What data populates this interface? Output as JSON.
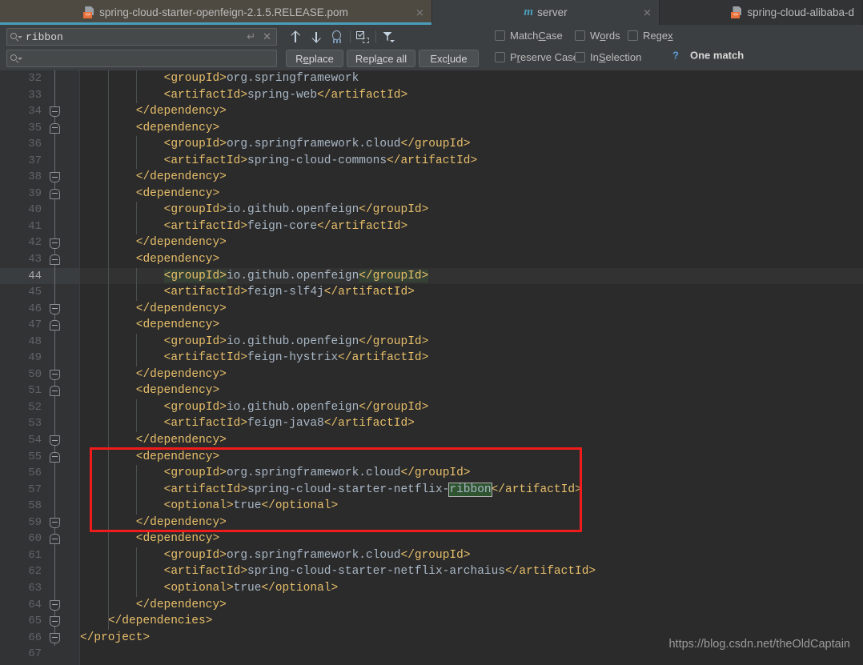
{
  "tabs": [
    {
      "label": "spring-cloud-starter-openfeign-2.1.5.RELEASE.pom",
      "icon": "pom-file-icon",
      "active": true,
      "closable": true
    },
    {
      "label": "server",
      "icon": "maven-module-icon",
      "active": false,
      "closable": true
    },
    {
      "label": "spring-cloud-alibaba-d",
      "icon": "pom-file-icon",
      "active": false,
      "closable": false
    }
  ],
  "find": {
    "search_value": "ribbon",
    "search_placeholder": "",
    "replace_value": "",
    "replace_placeholder": "",
    "enter_glyph": "↵",
    "clear_glyph": "✕",
    "toolbar": {
      "prev_title": "prev-occurrence",
      "next_title": "next-occurrence",
      "find_all_title": "find-all",
      "select_all_title": "select-all-occurrences",
      "filter_title": "filter-search-options"
    },
    "buttons": {
      "replace": {
        "pre": "R",
        "mnemonic": "e",
        "post": "place"
      },
      "replace_all": {
        "pre": "Repl",
        "mnemonic": "a",
        "post": "ce all"
      },
      "exclude": {
        "pre": "Exc",
        "mnemonic": "l",
        "post": "ude"
      }
    },
    "checkboxes": [
      {
        "pre": "Match ",
        "mnemonic": "C",
        "post": "ase",
        "checked": false
      },
      {
        "pre": "W",
        "mnemonic": "o",
        "post": "rds",
        "checked": false
      },
      {
        "pre": "Rege",
        "mnemonic": "x",
        "post": "",
        "checked": false
      },
      {
        "pre": "P",
        "mnemonic": "r",
        "post": "eserve Case",
        "checked": false
      },
      {
        "pre": "In ",
        "mnemonic": "S",
        "post": "election",
        "checked": false
      }
    ],
    "help_glyph": "?",
    "status": "One match"
  },
  "editor": {
    "first_line": 32,
    "caret_line": 44,
    "lines": [
      {
        "n": 32,
        "indent": 12,
        "tokens": [
          {
            "c": "t",
            "s": "<groupId>"
          },
          {
            "c": "v",
            "s": "org.springframework"
          }
        ]
      },
      {
        "n": 33,
        "indent": 12,
        "tokens": [
          {
            "c": "t",
            "s": "<artifactId>"
          },
          {
            "c": "v",
            "s": "spring-web"
          },
          {
            "c": "t",
            "s": "</artifactId>"
          }
        ]
      },
      {
        "n": 34,
        "indent": 8,
        "tokens": [
          {
            "c": "t",
            "s": "</dependency>"
          }
        ]
      },
      {
        "n": 35,
        "indent": 8,
        "tokens": [
          {
            "c": "t",
            "s": "<dependency>"
          }
        ]
      },
      {
        "n": 36,
        "indent": 12,
        "tokens": [
          {
            "c": "t",
            "s": "<groupId>"
          },
          {
            "c": "v",
            "s": "org.springframework.cloud"
          },
          {
            "c": "t",
            "s": "</groupId>"
          }
        ]
      },
      {
        "n": 37,
        "indent": 12,
        "tokens": [
          {
            "c": "t",
            "s": "<artifactId>"
          },
          {
            "c": "v",
            "s": "spring-cloud-commons"
          },
          {
            "c": "t",
            "s": "</artifactId>"
          }
        ]
      },
      {
        "n": 38,
        "indent": 8,
        "tokens": [
          {
            "c": "t",
            "s": "</dependency>"
          }
        ]
      },
      {
        "n": 39,
        "indent": 8,
        "tokens": [
          {
            "c": "t",
            "s": "<dependency>"
          }
        ]
      },
      {
        "n": 40,
        "indent": 12,
        "tokens": [
          {
            "c": "t",
            "s": "<groupId>"
          },
          {
            "c": "v",
            "s": "io.github.openfeign"
          },
          {
            "c": "t",
            "s": "</groupId>"
          }
        ]
      },
      {
        "n": 41,
        "indent": 12,
        "tokens": [
          {
            "c": "t",
            "s": "<artifactId>"
          },
          {
            "c": "v",
            "s": "feign-core"
          },
          {
            "c": "t",
            "s": "</artifactId>"
          }
        ]
      },
      {
        "n": 42,
        "indent": 8,
        "tokens": [
          {
            "c": "t",
            "s": "</dependency>"
          }
        ]
      },
      {
        "n": 43,
        "indent": 8,
        "tokens": [
          {
            "c": "t",
            "s": "<dependency>"
          }
        ]
      },
      {
        "n": 44,
        "indent": 12,
        "tokens": [
          {
            "c": "t hl",
            "s": "<groupId>"
          },
          {
            "c": "v",
            "s": "io.github.openfeign"
          },
          {
            "c": "t hl",
            "s": "</groupId>"
          }
        ]
      },
      {
        "n": 45,
        "indent": 12,
        "tokens": [
          {
            "c": "t",
            "s": "<artifactId>"
          },
          {
            "c": "v",
            "s": "feign-slf4j"
          },
          {
            "c": "t",
            "s": "</artifactId>"
          }
        ]
      },
      {
        "n": 46,
        "indent": 8,
        "tokens": [
          {
            "c": "t",
            "s": "</dependency>"
          }
        ]
      },
      {
        "n": 47,
        "indent": 8,
        "tokens": [
          {
            "c": "t",
            "s": "<dependency>"
          }
        ]
      },
      {
        "n": 48,
        "indent": 12,
        "tokens": [
          {
            "c": "t",
            "s": "<groupId>"
          },
          {
            "c": "v",
            "s": "io.github.openfeign"
          },
          {
            "c": "t",
            "s": "</groupId>"
          }
        ]
      },
      {
        "n": 49,
        "indent": 12,
        "tokens": [
          {
            "c": "t",
            "s": "<artifactId>"
          },
          {
            "c": "v",
            "s": "feign-hystrix"
          },
          {
            "c": "t",
            "s": "</artifactId>"
          }
        ]
      },
      {
        "n": 50,
        "indent": 8,
        "tokens": [
          {
            "c": "t",
            "s": "</dependency>"
          }
        ]
      },
      {
        "n": 51,
        "indent": 8,
        "tokens": [
          {
            "c": "t",
            "s": "<dependency>"
          }
        ]
      },
      {
        "n": 52,
        "indent": 12,
        "tokens": [
          {
            "c": "t",
            "s": "<groupId>"
          },
          {
            "c": "v",
            "s": "io.github.openfeign"
          },
          {
            "c": "t",
            "s": "</groupId>"
          }
        ]
      },
      {
        "n": 53,
        "indent": 12,
        "tokens": [
          {
            "c": "t",
            "s": "<artifactId>"
          },
          {
            "c": "v",
            "s": "feign-java8"
          },
          {
            "c": "t",
            "s": "</artifactId>"
          }
        ]
      },
      {
        "n": 54,
        "indent": 8,
        "tokens": [
          {
            "c": "t",
            "s": "</dependency>"
          }
        ]
      },
      {
        "n": 55,
        "indent": 8,
        "tokens": [
          {
            "c": "t",
            "s": "<dependency>"
          }
        ]
      },
      {
        "n": 56,
        "indent": 12,
        "tokens": [
          {
            "c": "t",
            "s": "<groupId>"
          },
          {
            "c": "v",
            "s": "org.springframework.cloud"
          },
          {
            "c": "t",
            "s": "</groupId>"
          }
        ]
      },
      {
        "n": 57,
        "indent": 12,
        "tokens": [
          {
            "c": "t",
            "s": "<artifactId>"
          },
          {
            "c": "v",
            "s": "spring-cloud-starter-netflix-"
          },
          {
            "c": "v match",
            "s": "ribbon"
          },
          {
            "c": "t",
            "s": "</artifactId>"
          }
        ]
      },
      {
        "n": 58,
        "indent": 12,
        "tokens": [
          {
            "c": "t",
            "s": "<optional>"
          },
          {
            "c": "v",
            "s": "true"
          },
          {
            "c": "t",
            "s": "</optional>"
          }
        ]
      },
      {
        "n": 59,
        "indent": 8,
        "tokens": [
          {
            "c": "t",
            "s": "</dependency>"
          }
        ]
      },
      {
        "n": 60,
        "indent": 8,
        "tokens": [
          {
            "c": "t",
            "s": "<dependency>"
          }
        ]
      },
      {
        "n": 61,
        "indent": 12,
        "tokens": [
          {
            "c": "t",
            "s": "<groupId>"
          },
          {
            "c": "v",
            "s": "org.springframework.cloud"
          },
          {
            "c": "t",
            "s": "</groupId>"
          }
        ]
      },
      {
        "n": 62,
        "indent": 12,
        "tokens": [
          {
            "c": "t",
            "s": "<artifactId>"
          },
          {
            "c": "v",
            "s": "spring-cloud-starter-netflix-archaius"
          },
          {
            "c": "t",
            "s": "</artifactId>"
          }
        ]
      },
      {
        "n": 63,
        "indent": 12,
        "tokens": [
          {
            "c": "t",
            "s": "<optional>"
          },
          {
            "c": "v",
            "s": "true"
          },
          {
            "c": "t",
            "s": "</optional>"
          }
        ]
      },
      {
        "n": 64,
        "indent": 8,
        "tokens": [
          {
            "c": "t",
            "s": "</dependency>"
          }
        ]
      },
      {
        "n": 65,
        "indent": 4,
        "tokens": [
          {
            "c": "t",
            "s": "</dependencies>"
          }
        ]
      },
      {
        "n": 66,
        "indent": 0,
        "tokens": [
          {
            "c": "t",
            "s": "</project>"
          }
        ]
      },
      {
        "n": 67,
        "indent": 0,
        "tokens": []
      }
    ],
    "fold_markers": [
      {
        "line": 34,
        "type": "bot"
      },
      {
        "line": 35,
        "type": "top"
      },
      {
        "line": 38,
        "type": "bot"
      },
      {
        "line": 39,
        "type": "top"
      },
      {
        "line": 42,
        "type": "bot"
      },
      {
        "line": 43,
        "type": "top"
      },
      {
        "line": 46,
        "type": "bot"
      },
      {
        "line": 47,
        "type": "top"
      },
      {
        "line": 50,
        "type": "bot"
      },
      {
        "line": 51,
        "type": "top"
      },
      {
        "line": 54,
        "type": "bot"
      },
      {
        "line": 55,
        "type": "top"
      },
      {
        "line": 59,
        "type": "bot"
      },
      {
        "line": 60,
        "type": "top"
      },
      {
        "line": 64,
        "type": "bot"
      },
      {
        "line": 65,
        "type": "bot"
      },
      {
        "line": 66,
        "type": "bot"
      }
    ],
    "annotation_box": {
      "from_line": 55,
      "to_line": 59,
      "color": "#f01b1b"
    }
  },
  "watermark": "https://blog.csdn.net/theOldCaptain",
  "colors": {
    "accent": "#4a9ebb",
    "tag": "#e8bf6a",
    "value": "#a9b7c6",
    "match_bg": "#2f5430",
    "pair_hl": "#344134",
    "annotation": "#f01b1b"
  }
}
